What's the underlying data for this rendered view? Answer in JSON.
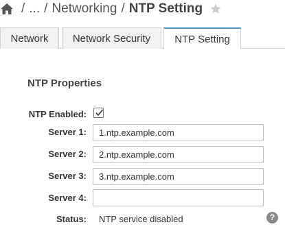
{
  "breadcrumb": {
    "ellipsis": "...",
    "separator": "/",
    "parent": "Networking",
    "current": "NTP Setting"
  },
  "tabs": [
    {
      "label": "Network",
      "active": false
    },
    {
      "label": "Network Security",
      "active": false
    },
    {
      "label": "NTP Setting",
      "active": true
    }
  ],
  "section": {
    "title": "NTP Properties"
  },
  "form": {
    "enabled_label": "NTP Enabled:",
    "enabled": true,
    "servers": [
      {
        "label": "Server 1:",
        "value": "1.ntp.example.com"
      },
      {
        "label": "Server 2:",
        "value": "2.ntp.example.com"
      },
      {
        "label": "Server 3:",
        "value": "3.ntp.example.com"
      },
      {
        "label": "Server 4:",
        "value": ""
      }
    ],
    "status_label": "Status:",
    "status_value": "NTP service disabled"
  },
  "icons": {
    "home": "home-icon",
    "favorite": "star-icon",
    "help": "help-icon",
    "help_glyph": "?"
  },
  "colors": {
    "active_tab_accent": "#4a97c8",
    "star": "#cccccc",
    "help_icon_bg": "#8a8a8a"
  }
}
